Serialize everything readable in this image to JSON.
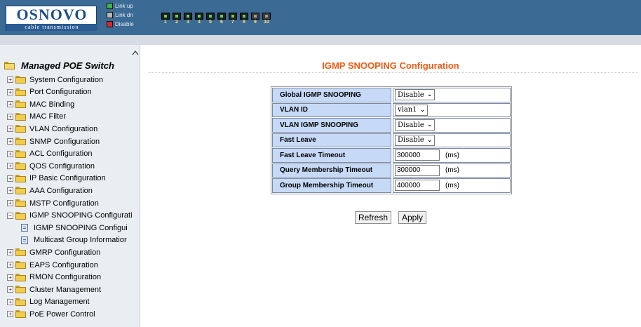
{
  "header": {
    "logo_text": "OSNOVO",
    "logo_sub": "cable transmission",
    "legend": [
      {
        "label": "Link up",
        "color": "#3fb34a"
      },
      {
        "label": "Link dn",
        "color": "#b8b8b8"
      },
      {
        "label": "Disable",
        "color": "#d42a2a"
      }
    ],
    "ports": [
      {
        "num": "1",
        "state": "up"
      },
      {
        "num": "2",
        "state": "up"
      },
      {
        "num": "3",
        "state": "up"
      },
      {
        "num": "4",
        "state": "up"
      },
      {
        "num": "5",
        "state": "up"
      },
      {
        "num": "6",
        "state": "up"
      },
      {
        "num": "7",
        "state": "up"
      },
      {
        "num": "8",
        "state": "up"
      },
      {
        "num": "9",
        "state": "down"
      },
      {
        "num": "10",
        "state": "down"
      }
    ]
  },
  "sidebar": {
    "root": "Managed POE Switch",
    "items": [
      {
        "label": "System Configuration"
      },
      {
        "label": "Port Configuration"
      },
      {
        "label": "MAC Binding"
      },
      {
        "label": "MAC Filter"
      },
      {
        "label": "VLAN Configuration"
      },
      {
        "label": "SNMP Configuration"
      },
      {
        "label": "ACL Configuration"
      },
      {
        "label": "QOS Configuration"
      },
      {
        "label": "IP Basic Configuration"
      },
      {
        "label": "AAA Configuration"
      },
      {
        "label": "MSTP Configuration"
      },
      {
        "label": "IGMP SNOOPING Configurati",
        "expanded": true
      },
      {
        "label": "GMRP Configuration"
      },
      {
        "label": "EAPS Configuration"
      },
      {
        "label": "RMON Configuration"
      },
      {
        "label": "Cluster Management"
      },
      {
        "label": "Log Management"
      },
      {
        "label": "PoE Power Control"
      }
    ],
    "subitems": [
      {
        "label": "IGMP SNOOPING Configui"
      },
      {
        "label": "Multicast Group Informatior"
      }
    ]
  },
  "main": {
    "title": "IGMP SNOOPING Configuration",
    "rows": [
      {
        "label": "Global IGMP SNOOPING",
        "type": "select",
        "value": "Disable"
      },
      {
        "label": "VLAN ID",
        "type": "select",
        "value": "vlan1"
      },
      {
        "label": "VLAN IGMP SNOOPING",
        "type": "select",
        "value": "Disable"
      },
      {
        "label": "Fast Leave",
        "type": "select",
        "value": "Disable"
      },
      {
        "label": "Fast Leave Timeout",
        "type": "input",
        "value": "300000",
        "unit": "(ms)"
      },
      {
        "label": "Query Membership Timeout",
        "type": "input",
        "value": "300000",
        "unit": "(ms)"
      },
      {
        "label": "Group Membership Timeout",
        "type": "input",
        "value": "400000",
        "unit": "(ms)"
      }
    ],
    "buttons": {
      "refresh": "Refresh",
      "apply": "Apply"
    }
  }
}
